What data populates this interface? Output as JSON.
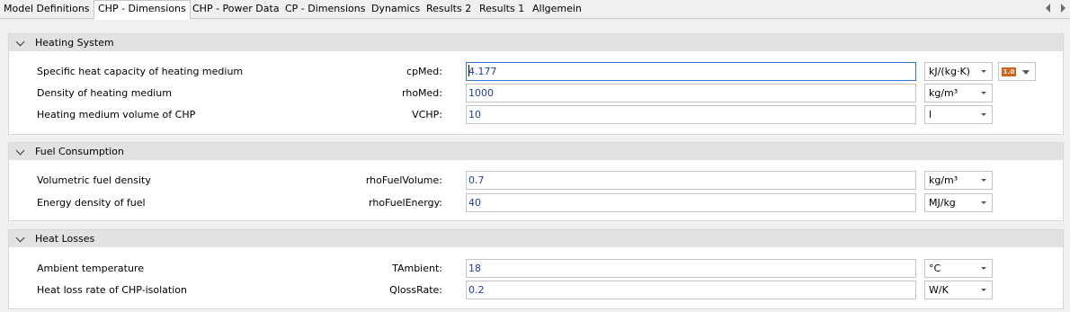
{
  "tabs": [
    {
      "label": "Model Definitions"
    },
    {
      "label": "CHP - Dimensions"
    },
    {
      "label": "CHP - Power Data"
    },
    {
      "label": "CP - Dimensions"
    },
    {
      "label": "Dynamics"
    },
    {
      "label": "Results 2"
    },
    {
      "label": "Results 1"
    },
    {
      "label": "Allgemein"
    }
  ],
  "active_tab": "CHP - Dimensions",
  "sections": [
    {
      "title": "Heating System",
      "rows": [
        {
          "label": "Specific heat capacity of heating medium",
          "param": "cpMed:",
          "value": "4.177",
          "unit": "kJ/(kg·K)"
        },
        {
          "label": "Density of heating medium",
          "param": "rhoMed:",
          "value": "1000",
          "unit": "kg/m³"
        },
        {
          "label": "Heating medium volume of CHP",
          "param": "VCHP:",
          "value": "10",
          "unit": "l"
        }
      ]
    },
    {
      "title": "Fuel Consumption",
      "rows": [
        {
          "label": "Volumetric fuel density",
          "param": "rhoFuelVolume:",
          "value": "0.7",
          "unit": "kg/m³"
        },
        {
          "label": "Energy density of fuel",
          "param": "rhoFuelEnergy:",
          "value": "40",
          "unit": "MJ/kg"
        }
      ]
    },
    {
      "title": "Heat Losses",
      "rows": [
        {
          "label": "Ambient temperature",
          "param": "TAmbient:",
          "value": "18",
          "unit": "°C"
        },
        {
          "label": "Heat loss rate of CHP-isolation",
          "param": "QlossRate:",
          "value": "0.2",
          "unit": "W/K"
        }
      ]
    }
  ],
  "version_badge": "1.0",
  "colors": {
    "badge": "#d8641c",
    "value_text": "#1f3cae",
    "focus_border": "#2d76d4"
  }
}
